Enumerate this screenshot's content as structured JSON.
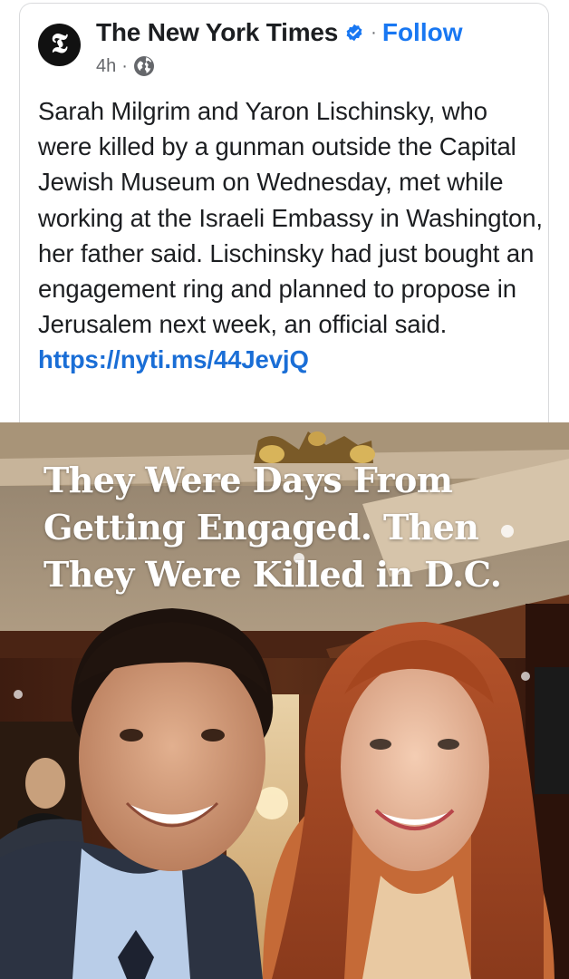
{
  "post": {
    "page_name": "The New York Times",
    "avatar_glyph": "𝕿",
    "separator": "·",
    "follow_label": "Follow",
    "time": "4h",
    "meta_separator": "·",
    "audience_icon": "globe-icon",
    "verified_icon": "verified-badge-icon",
    "text": "Sarah Milgrim and Yaron Lischinsky, who were killed by a gunman outside the Capital Jewish Museum on Wednesday, met while working at the Israeli Embassy in Washington, her father said. Lischinsky had just bought an engagement ring and planned to propose in Jerusalem next week, an official said. ",
    "link": "https://nyti.ms/44JevjQ"
  },
  "photo": {
    "headline": "They Were Days From Getting Engaged. Then They Were Killed in D.C."
  },
  "colors": {
    "accent": "#1877f2",
    "link": "#1a6ed6",
    "text": "#1c1e21",
    "muted": "#65676b"
  }
}
